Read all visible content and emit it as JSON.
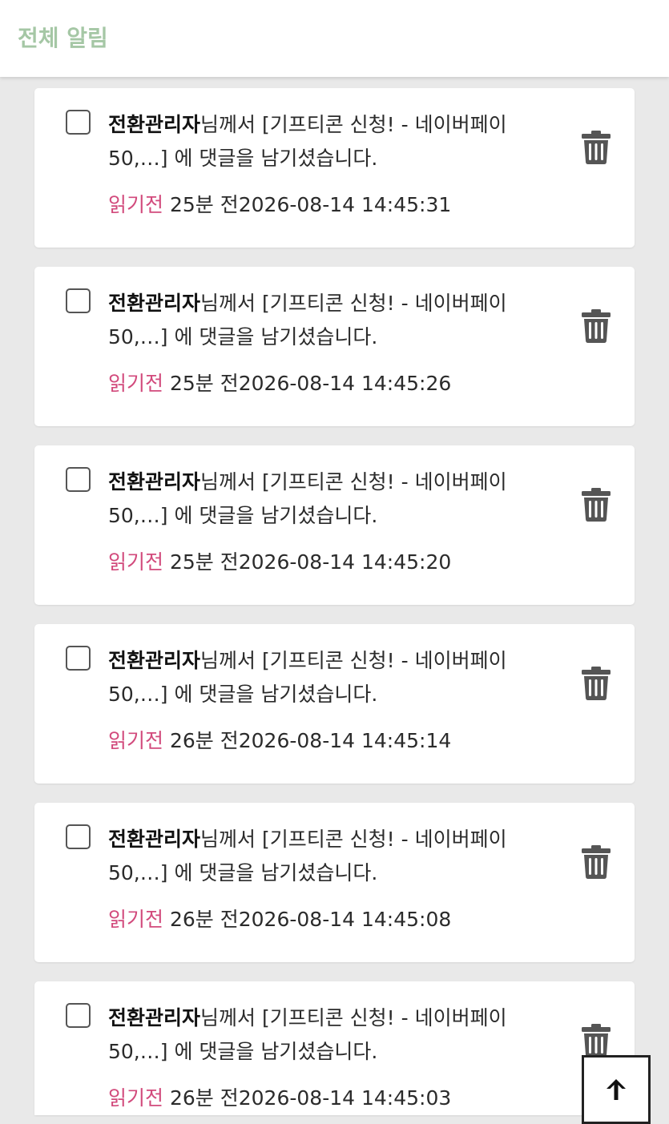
{
  "header": {
    "title": "전체 알림"
  },
  "notifications": [
    {
      "sender": "전환관리자",
      "message": "님께서 [기프티콘 신청! - 네이버페이 50,…] 에 댓글을 남기셨습니다.",
      "status": "읽기전",
      "time_ago": "25분 전",
      "timestamp": "2026-08-14 14:45:31"
    },
    {
      "sender": "전환관리자",
      "message": "님께서 [기프티콘 신청! - 네이버페이 50,…] 에 댓글을 남기셨습니다.",
      "status": "읽기전",
      "time_ago": "25분 전",
      "timestamp": "2026-08-14 14:45:26"
    },
    {
      "sender": "전환관리자",
      "message": "님께서 [기프티콘 신청! - 네이버페이 50,…] 에 댓글을 남기셨습니다.",
      "status": "읽기전",
      "time_ago": "25분 전",
      "timestamp": "2026-08-14 14:45:20"
    },
    {
      "sender": "전환관리자",
      "message": "님께서 [기프티콘 신청! - 네이버페이 50,…] 에 댓글을 남기셨습니다.",
      "status": "읽기전",
      "time_ago": "26분 전",
      "timestamp": "2026-08-14 14:45:14"
    },
    {
      "sender": "전환관리자",
      "message": "님께서 [기프티콘 신청! - 네이버페이 50,…] 에 댓글을 남기셨습니다.",
      "status": "읽기전",
      "time_ago": "26분 전",
      "timestamp": "2026-08-14 14:45:08"
    },
    {
      "sender": "전환관리자",
      "message": "님께서 [기프티콘 신청! - 네이버페이 50,…] 에 댓글을 남기셨습니다.",
      "status": "읽기전",
      "time_ago": "26분 전",
      "timestamp": "2026-08-14 14:45:03"
    }
  ],
  "icons": {
    "delete": "trash-icon",
    "scroll_top": "arrow-up-icon"
  },
  "colors": {
    "title": "#a5c7a5",
    "unread": "#d24a7c",
    "background": "#e9e9e9"
  }
}
